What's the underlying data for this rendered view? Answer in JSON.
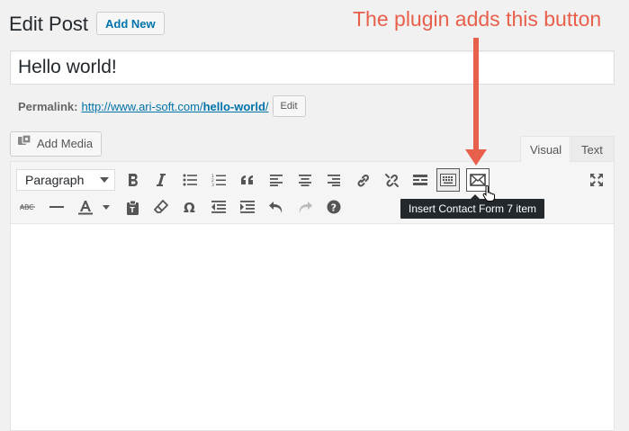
{
  "header": {
    "title": "Edit Post",
    "add_new_label": "Add New"
  },
  "annotation": {
    "text": "The plugin adds this button",
    "color": "#e8604c"
  },
  "post": {
    "title_value": "Hello world!"
  },
  "permalink": {
    "label": "Permalink:",
    "url_base": "http://www.ari-soft.com/",
    "slug": "hello-world",
    "url_trailing": "/",
    "edit_label": "Edit"
  },
  "media": {
    "add_media_label": "Add Media"
  },
  "editor_tabs": {
    "visual_label": "Visual",
    "text_label": "Text",
    "active": "Visual"
  },
  "toolbar": {
    "format_value": "Paragraph",
    "row1_icons": [
      "bold-icon",
      "italic-icon",
      "bulleted-list-icon",
      "numbered-list-icon",
      "blockquote-icon",
      "align-left-icon",
      "align-center-icon",
      "align-right-icon",
      "insert-link-icon",
      "remove-link-icon",
      "read-more-icon",
      "toolbar-toggle-icon",
      "contact-form-icon",
      "fullscreen-icon"
    ],
    "row2_icons": [
      "strikethrough-icon",
      "horizontal-line-icon",
      "text-color-icon",
      "paste-as-text-icon",
      "clear-formatting-icon",
      "special-character-icon",
      "decrease-indent-icon",
      "increase-indent-icon",
      "undo-icon",
      "redo-icon",
      "help-icon"
    ],
    "tooltip": "Insert Contact Form 7 item"
  },
  "colors": {
    "link": "#0073aa",
    "tooltip_bg": "#23282d"
  }
}
